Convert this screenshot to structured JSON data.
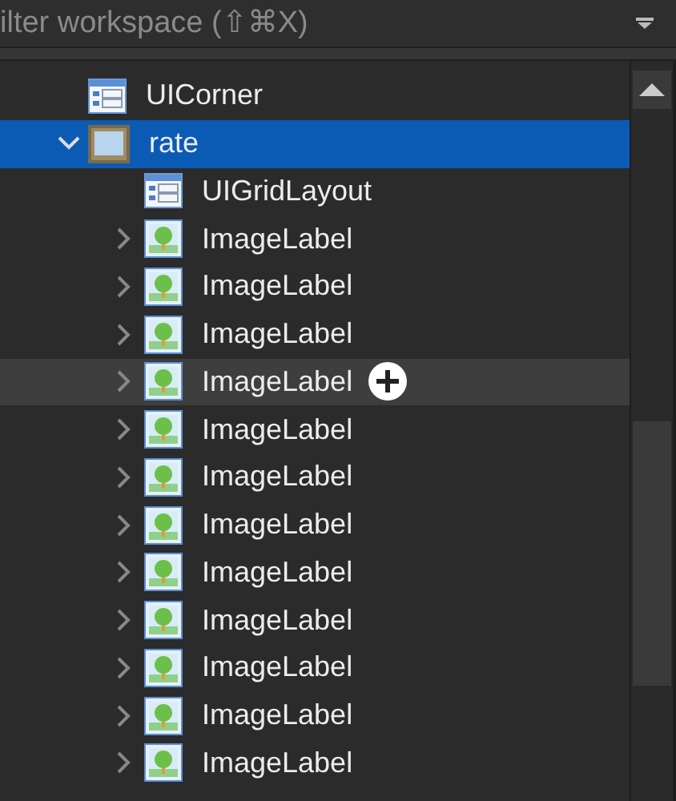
{
  "search": {
    "placeholder": "ilter workspace (⇧⌘X)"
  },
  "tree": [
    {
      "label": "UICorner",
      "kind": "layout",
      "selected": false,
      "hovered": false
    },
    {
      "label": "rate",
      "kind": "frame",
      "selected": true,
      "hovered": false,
      "expanded": true,
      "children": [
        {
          "label": "UIGridLayout",
          "kind": "layout",
          "selected": false,
          "hovered": false
        },
        {
          "label": "ImageLabel",
          "kind": "image",
          "selected": false,
          "hovered": false,
          "expanded": false
        },
        {
          "label": "ImageLabel",
          "kind": "image",
          "selected": false,
          "hovered": false,
          "expanded": false
        },
        {
          "label": "ImageLabel",
          "kind": "image",
          "selected": false,
          "hovered": false,
          "expanded": false
        },
        {
          "label": "ImageLabel",
          "kind": "image",
          "selected": false,
          "hovered": true,
          "expanded": false
        },
        {
          "label": "ImageLabel",
          "kind": "image",
          "selected": false,
          "hovered": false,
          "expanded": false
        },
        {
          "label": "ImageLabel",
          "kind": "image",
          "selected": false,
          "hovered": false,
          "expanded": false
        },
        {
          "label": "ImageLabel",
          "kind": "image",
          "selected": false,
          "hovered": false,
          "expanded": false
        },
        {
          "label": "ImageLabel",
          "kind": "image",
          "selected": false,
          "hovered": false,
          "expanded": false
        },
        {
          "label": "ImageLabel",
          "kind": "image",
          "selected": false,
          "hovered": false,
          "expanded": false
        },
        {
          "label": "ImageLabel",
          "kind": "image",
          "selected": false,
          "hovered": false,
          "expanded": false
        },
        {
          "label": "ImageLabel",
          "kind": "image",
          "selected": false,
          "hovered": false,
          "expanded": false
        },
        {
          "label": "ImageLabel",
          "kind": "image",
          "selected": false,
          "hovered": false,
          "expanded": false
        }
      ]
    }
  ]
}
